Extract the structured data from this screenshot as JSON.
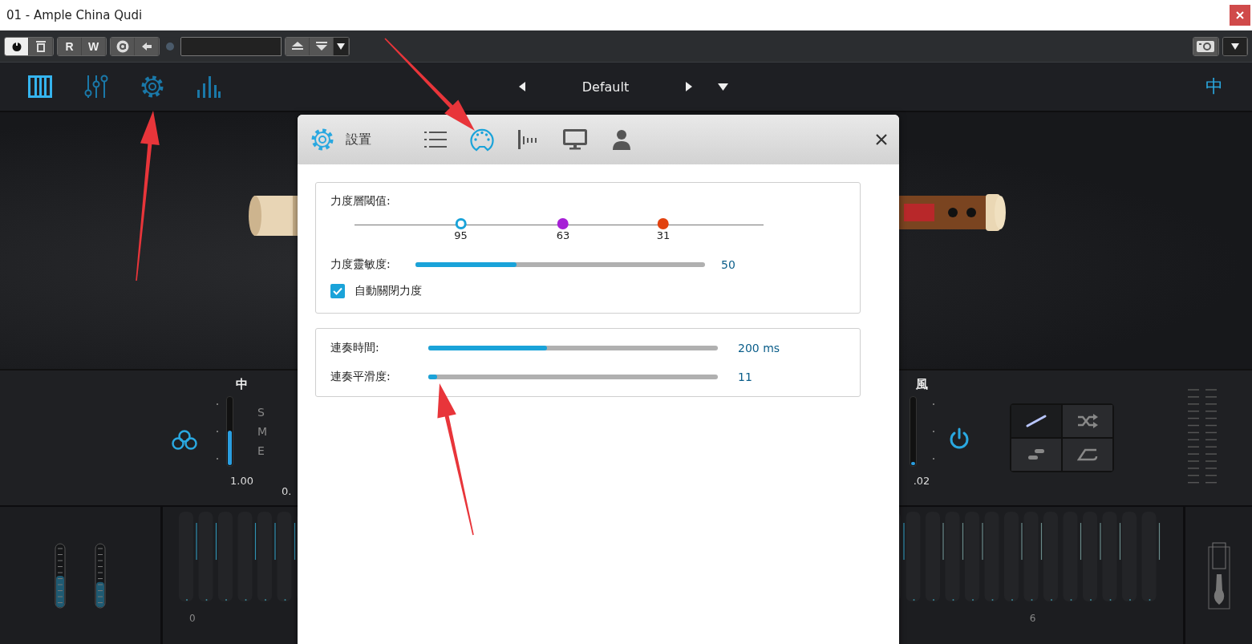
{
  "window": {
    "title": "01 - Ample China Qudi"
  },
  "toolbar": {
    "power_on": true,
    "buttons": [
      "R",
      "W"
    ]
  },
  "nav": {
    "tabs": [
      {
        "kind": "keys",
        "selected": true
      },
      {
        "kind": "mixer",
        "selected": false
      },
      {
        "kind": "settings",
        "selected": false
      },
      {
        "kind": "meter",
        "selected": false
      }
    ],
    "preset": "Default",
    "language": "中"
  },
  "mixer": {
    "left_channel": {
      "label": "中",
      "level": 0.5,
      "value": "1.00",
      "modes": [
        "S",
        "M",
        "E"
      ]
    },
    "partial_value": "0.",
    "right_channel": {
      "label": "風",
      "level": 0.03,
      "value": ".02"
    },
    "power_on": true,
    "articulations": [
      {
        "kind": "legato",
        "selected": true
      },
      {
        "kind": "shuffle",
        "selected": false
      },
      {
        "kind": "slide",
        "selected": false
      },
      {
        "kind": "loop",
        "selected": false
      }
    ]
  },
  "keyboard": {
    "wheels": [
      {
        "level": 0.5
      },
      {
        "level": 0.4
      }
    ],
    "octave_labels": [
      "0",
      "6"
    ]
  },
  "dialog": {
    "title": "設置",
    "tabs": [
      {
        "kind": "list",
        "selected": false
      },
      {
        "kind": "midi",
        "selected": true
      },
      {
        "kind": "fader",
        "selected": false
      },
      {
        "kind": "display",
        "selected": false
      },
      {
        "kind": "user",
        "selected": false
      }
    ],
    "velocity": {
      "title": "力度層閾值:",
      "thresholds": [
        {
          "value": "95",
          "color": "#1aa3d9",
          "level": 0.26,
          "selected": true
        },
        {
          "value": "63",
          "color": "#a61fd6",
          "level": 0.51,
          "selected": false
        },
        {
          "value": "31",
          "color": "#e2420f",
          "level": 0.755,
          "selected": false
        }
      ],
      "sensitivity": {
        "label": "力度靈敏度:",
        "level": 0.35,
        "reading": "50"
      },
      "auto_off": {
        "label": "自動關閉力度",
        "checked": true
      }
    },
    "legato": [
      {
        "label": "連奏時間:",
        "level": 0.41,
        "reading": "200 ms"
      },
      {
        "label": "連奏平滑度:",
        "level": 0.03,
        "reading": "11"
      }
    ]
  }
}
